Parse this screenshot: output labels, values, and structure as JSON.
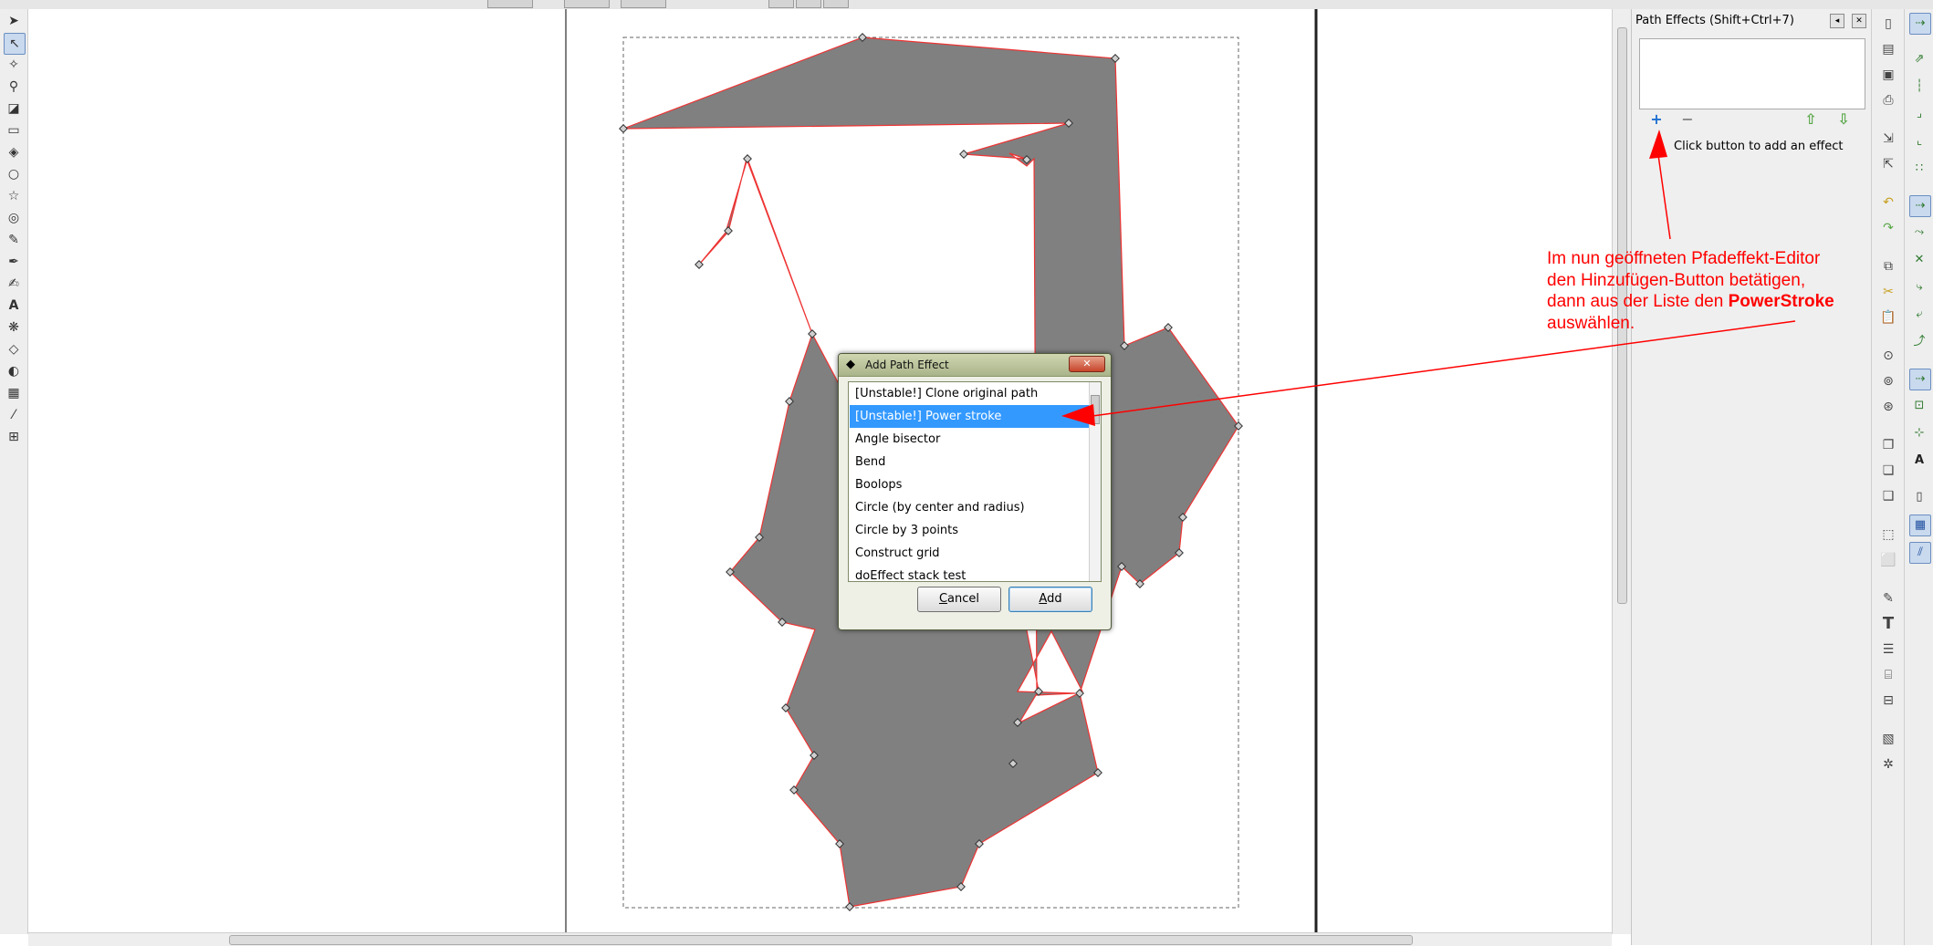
{
  "panel": {
    "title": "Path Effects  (Shift+Ctrl+7)",
    "hint": "Click button to add an effect"
  },
  "dialog": {
    "title": "Add Path Effect",
    "items": [
      "[Unstable!] Clone original path",
      "[Unstable!] Power stroke",
      "Angle bisector",
      "Bend",
      "Boolops",
      "Circle (by center and radius)",
      "Circle by 3 points",
      "Construct grid",
      "doEffect stack test"
    ],
    "selected_index": 1,
    "cancel_label": "Cancel",
    "add_label": "Add"
  },
  "annotation": {
    "line1": "Im nun geöffneten Pfadeffekt-Editor",
    "line2": "den Hinzufügen-Button betätigen,",
    "line3_pre": "dann aus der Liste den ",
    "line3_bold": "PowerStroke",
    "line4": "auswählen."
  },
  "colors": {
    "shape_fill": "#808080",
    "shape_stroke": "#ee3333",
    "selection": "#3399ff",
    "annotation": "#ff0000"
  }
}
